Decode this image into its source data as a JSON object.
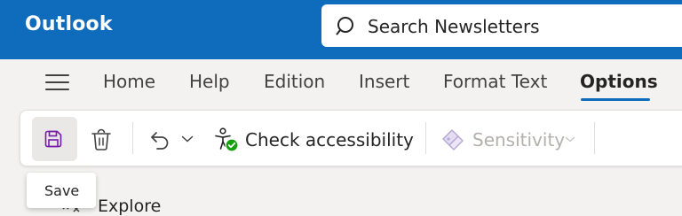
{
  "colors": {
    "brand": "#0f6cbd",
    "ribbon_bg": "#ffffff",
    "page_bg": "#f3f2f1",
    "save_icon": "#7719aa",
    "accessibility_check": "#13a10e",
    "disabled_text": "#b3b0ad"
  },
  "header": {
    "app_name": "Outlook",
    "search": {
      "icon": "search-icon",
      "text": "Search Newsletters"
    }
  },
  "tabs": {
    "menu_icon": "hamburger-menu-icon",
    "items": [
      {
        "label": "Home",
        "active": false
      },
      {
        "label": "Help",
        "active": false
      },
      {
        "label": "Edition",
        "active": false
      },
      {
        "label": "Insert",
        "active": false
      },
      {
        "label": "Format Text",
        "active": false
      },
      {
        "label": "Options",
        "active": true
      }
    ]
  },
  "ribbon": {
    "save": {
      "icon": "save-icon",
      "tooltip": "Save",
      "hovered": true
    },
    "delete": {
      "icon": "trash-icon"
    },
    "undo": {
      "icon": "undo-icon",
      "menu_icon": "chevron-down-icon"
    },
    "check_accessibility": {
      "icon": "accessibility-checker-icon",
      "label": "Check accessibility"
    },
    "sensitivity": {
      "icon": "sensitivity-shield-icon",
      "label": "Sensitivity",
      "enabled": false
    }
  },
  "below": {
    "explore_label": "Explore",
    "icon": "expand-icon"
  }
}
